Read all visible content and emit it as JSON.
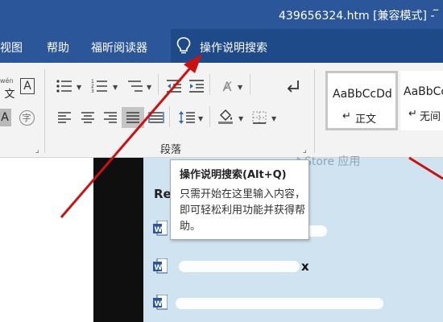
{
  "window": {
    "title": "439656324.htm [兼容模式] -",
    "minimize_label": "–"
  },
  "menu": {
    "items": [
      "视图",
      "帮助",
      "福昕阅读器"
    ],
    "tell_me": "操作说明搜索"
  },
  "ribbon": {
    "font_group": {
      "pinyin_label": "wén",
      "border_letter": "A",
      "char_shading_letter": "A",
      "enclose_char": "字"
    },
    "paragraph_group": {
      "label": "段落"
    },
    "styles": [
      {
        "sample": "AaBbCcDd",
        "name": "正文",
        "mark": "↵"
      },
      {
        "sample": "AaBbCcDd",
        "name": "无间",
        "mark": "↵"
      }
    ]
  },
  "tooltip": {
    "title": "操作说明搜索(Alt+Q)",
    "body": "只需开始在这里输入内容，即可轻松利用功能并获得帮助。"
  },
  "document": {
    "store_text": "t Store 应用",
    "recent_label": "Re",
    "items": [
      {
        "icon": "word-doc-icon",
        "text": ""
      },
      {
        "icon": "word-doc-icon",
        "text": "x"
      },
      {
        "icon": "word-doc-icon",
        "text": ""
      }
    ]
  },
  "colors": {
    "title_bar": "#2b579a",
    "arrow": "#cc1111"
  }
}
